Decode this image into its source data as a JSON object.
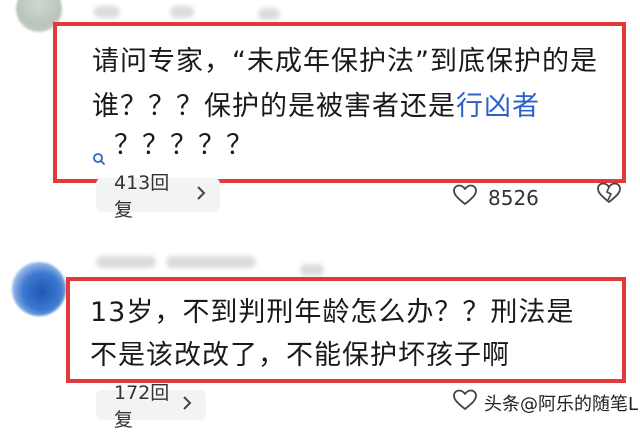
{
  "comments": [
    {
      "line1": "请问专家，“未成年保护法”到底保护的是",
      "line2_prefix": "谁？？？保护的是被害者还是",
      "line2_link": "行凶者",
      "line3": "？？？？？",
      "replies": "413回复",
      "likes": "8526"
    },
    {
      "line1": "13岁，不到判刑年龄怎么办？？刑法是",
      "line2": "不是该改改了，不能保护坏孩子啊",
      "replies": "172回复"
    }
  ],
  "watermark": "头条@阿乐的随笔L",
  "icons": {
    "link_search": "search-icon",
    "like": "heart-icon",
    "dislike": "broken-heart-icon",
    "chevron": "chevron-right-icon"
  },
  "colors": {
    "highlight_box": "#e4393c",
    "link": "#2a62c9"
  }
}
